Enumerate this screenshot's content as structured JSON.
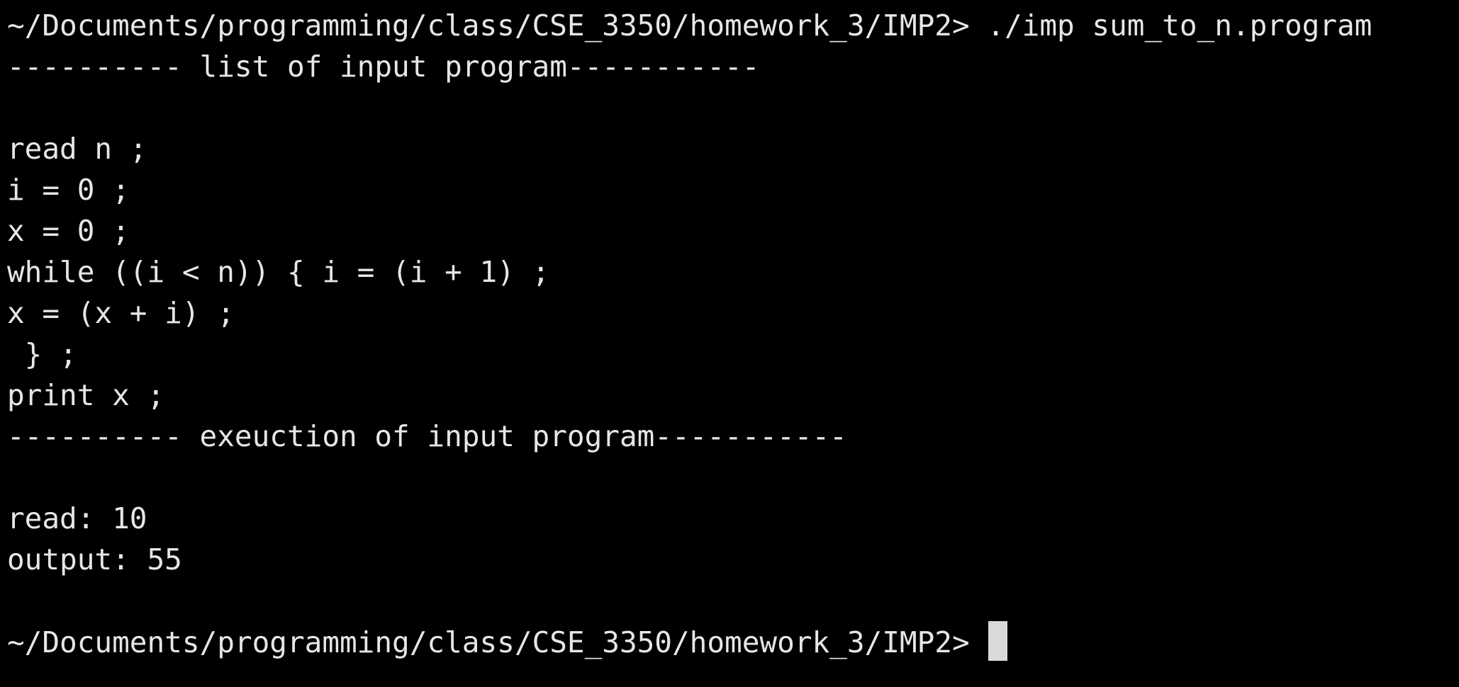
{
  "terminal": {
    "colors": {
      "background": "#000000",
      "text": "#e6e6e6",
      "cursor": "#d9d9d9"
    },
    "lines": [
      "~/Documents/programming/class/CSE_3350/homework_3/IMP2> ./imp sum_to_n.program",
      "---------- list of input program-----------",
      "",
      "read n ;",
      "i = 0 ;",
      "x = 0 ;",
      "while ((i < n)) { i = (i + 1) ;",
      "x = (x + i) ;",
      " } ;",
      "print x ;",
      "---------- exeuction of input program-----------",
      "",
      "read: 10",
      "output: 55",
      ""
    ],
    "prompt": "~/Documents/programming/class/CSE_3350/homework_3/IMP2> ",
    "input": ""
  }
}
